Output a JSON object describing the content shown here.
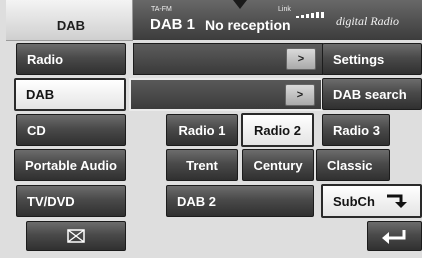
{
  "header": {
    "source_label": "DAB",
    "band_tag": "TA-FM",
    "station": "DAB 1",
    "status": "No reception",
    "link_label": "Link",
    "logo_text": "digital Radio"
  },
  "left_menu": [
    {
      "label": "Radio",
      "selected": false
    },
    {
      "label": "DAB",
      "selected": true
    },
    {
      "label": "CD",
      "selected": false
    },
    {
      "label": "Portable Audio",
      "selected": false
    },
    {
      "label": "TV/DVD",
      "selected": false
    }
  ],
  "right_menu": [
    {
      "label": "Settings"
    },
    {
      "label": "DAB search"
    },
    {
      "label": "Radio 3"
    },
    {
      "label": "Classic"
    },
    {
      "label": "SubCh"
    }
  ],
  "bar_arrow": ">",
  "presets": {
    "radio_1": "Radio 1",
    "radio_2": "Radio 2",
    "trent": "Trent",
    "century": "Century",
    "dab_2": "DAB 2"
  },
  "icons": {
    "mail": "mail-icon",
    "back": "back-arrow-icon",
    "subch": "return-arrow-icon"
  },
  "colors": {
    "button_dark": "#3c3c3c",
    "selected_bg": "#ffffff",
    "screen_bg": "#dedede"
  }
}
